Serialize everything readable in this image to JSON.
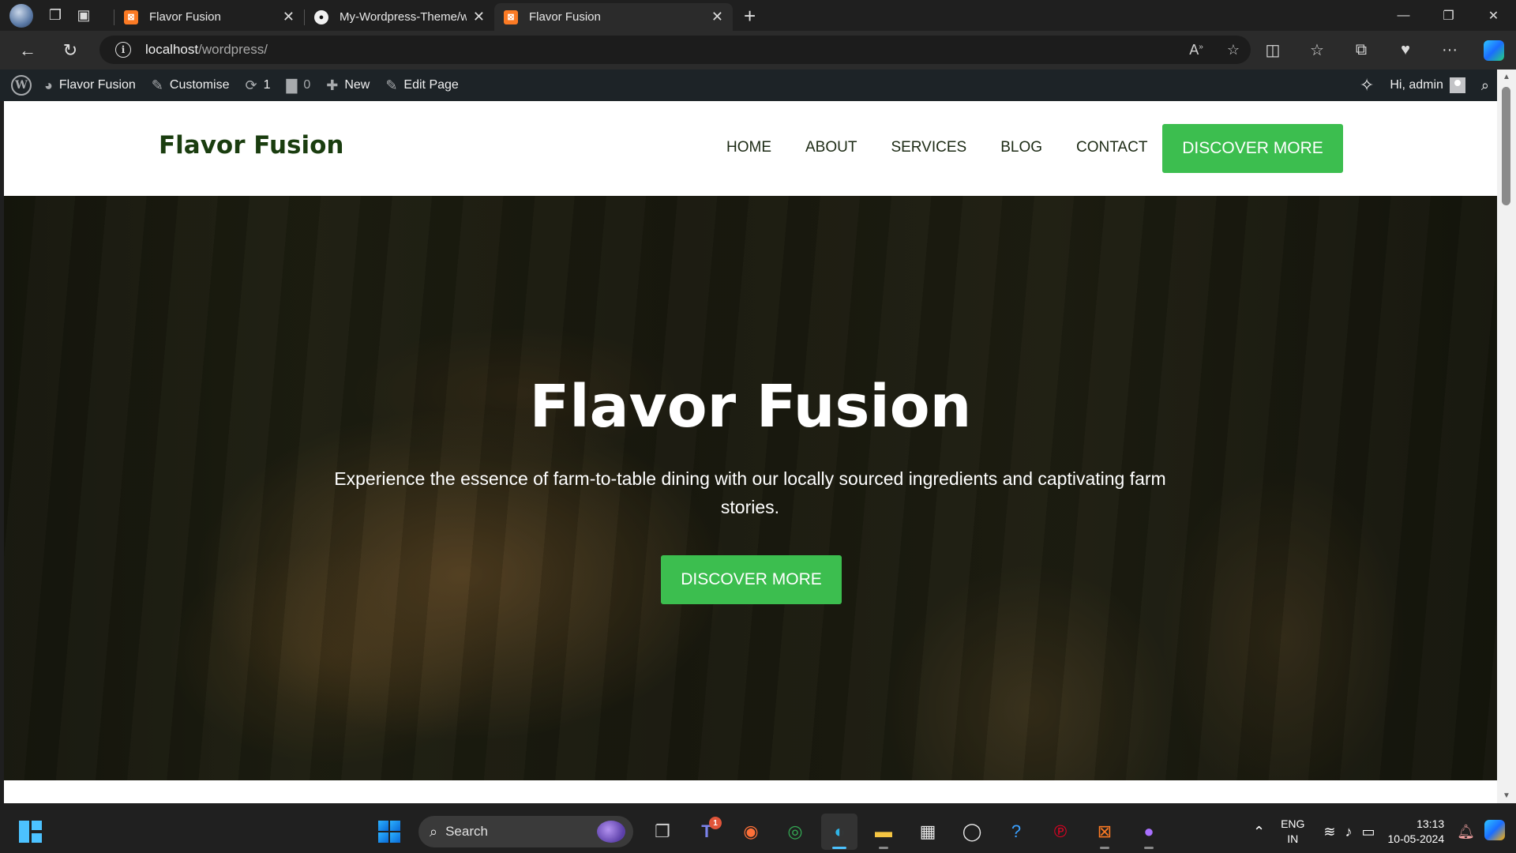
{
  "browser": {
    "tabs": [
      {
        "title": "Flavor Fusion",
        "favicon": "xampp-icon",
        "active": false
      },
      {
        "title": "My-Wordpress-Theme/wordpres",
        "favicon": "github-icon",
        "active": false
      },
      {
        "title": "Flavor Fusion",
        "favicon": "xampp-icon",
        "active": true
      }
    ],
    "url_host": "localhost",
    "url_path": "/wordpress/"
  },
  "wp_admin_bar": {
    "site_name": "Flavor Fusion",
    "customise": "Customise",
    "updates_count": "1",
    "comments_count": "0",
    "new_label": "New",
    "edit_page": "Edit Page",
    "greeting": "Hi, admin"
  },
  "site": {
    "logo": "Flavor Fusion",
    "nav": [
      "HOME",
      "ABOUT",
      "SERVICES",
      "BLOG",
      "CONTACT"
    ],
    "header_button": "DISCOVER MORE",
    "accent_color": "#3cbe4f",
    "logo_color": "#1a3d0f"
  },
  "hero": {
    "title": "Flavor Fusion",
    "subtitle": "Experience the essence of farm-to-table dining with our locally sourced ingredients and captivating farm stories.",
    "button": "DISCOVER MORE"
  },
  "taskbar": {
    "search_placeholder": "Search",
    "teams_badge": "1",
    "language": "ENG",
    "region": "IN",
    "time": "13:13",
    "date": "10-05-2024"
  }
}
